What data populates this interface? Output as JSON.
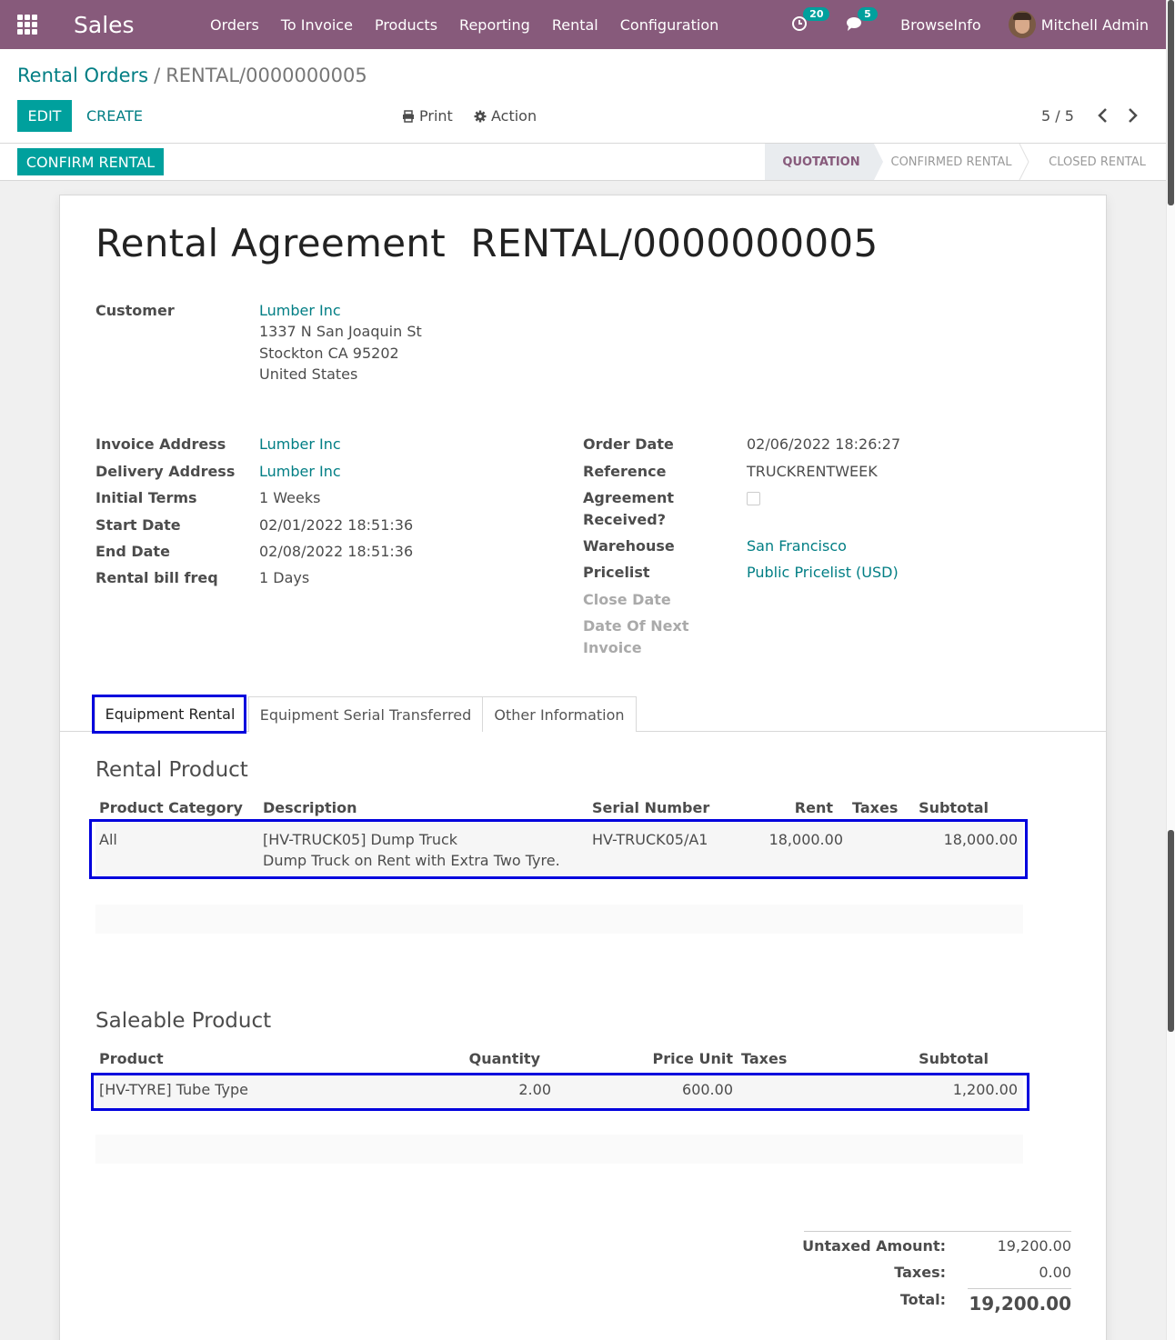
{
  "navbar": {
    "app_name": "Sales",
    "menu": [
      "Orders",
      "To Invoice",
      "Products",
      "Reporting",
      "Rental",
      "Configuration"
    ],
    "activity_count": "20",
    "message_count": "5",
    "company": "BrowseInfo",
    "user": "Mitchell Admin"
  },
  "breadcrumb": {
    "parent": "Rental Orders",
    "separator": "/",
    "current": "RENTAL/0000000005"
  },
  "toolbar": {
    "edit_label": "EDIT",
    "create_label": "CREATE",
    "print_label": "Print",
    "action_label": "Action",
    "pager": "5 / 5"
  },
  "statusbar": {
    "confirm_label": "CONFIRM RENTAL",
    "stages": [
      "QUOTATION",
      "CONFIRMED RENTAL",
      "CLOSED RENTAL"
    ],
    "active_stage": "QUOTATION"
  },
  "form": {
    "title": "Rental Agreement  RENTAL/0000000005",
    "customer_label": "Customer",
    "customer_name": "Lumber Inc",
    "customer_address": [
      "1337 N San Joaquin St",
      "Stockton CA 95202",
      "United States"
    ],
    "left_fields": [
      {
        "label": "Invoice Address",
        "value": "Lumber Inc"
      },
      {
        "label": "Delivery Address",
        "value": "Lumber Inc"
      },
      {
        "label": "Initial Terms",
        "value": "1 Weeks"
      },
      {
        "label": "Start Date",
        "value": "02/01/2022 18:51:36"
      },
      {
        "label": "End Date",
        "value": "02/08/2022 18:51:36"
      },
      {
        "label": "Rental bill freq",
        "value": "1 Days"
      }
    ],
    "right_fields": {
      "order_date_label": "Order Date",
      "order_date": "02/06/2022 18:26:27",
      "reference_label": "Reference",
      "reference": "TRUCKRENTWEEK",
      "agreement_label_1": "Agreement",
      "agreement_label_2": "Received?",
      "agreement_received": false,
      "warehouse_label": "Warehouse",
      "warehouse": "San Francisco",
      "pricelist_label": "Pricelist",
      "pricelist": "Public Pricelist (USD)",
      "close_date_label": "Close Date",
      "next_invoice_label_1": "Date Of Next",
      "next_invoice_label_2": "Invoice"
    }
  },
  "tabs": [
    "Equipment Rental",
    "Equipment Serial Transferred",
    "Other Information"
  ],
  "rental_product": {
    "title": "Rental Product",
    "columns": [
      "Product Category",
      "Description",
      "Serial Number",
      "Rent",
      "Taxes",
      "Subtotal"
    ],
    "rows": [
      {
        "category": "All",
        "description_1": "[HV-TRUCK05] Dump Truck",
        "description_2": "Dump Truck on Rent with Extra Two Tyre.",
        "serial": "HV-TRUCK05/A1",
        "rent": "18,000.00",
        "taxes": "",
        "subtotal": "18,000.00"
      }
    ]
  },
  "saleable_product": {
    "title": "Saleable Product",
    "columns": [
      "Product",
      "Quantity",
      "Price Unit",
      "Taxes",
      "Subtotal"
    ],
    "rows": [
      {
        "product": "[HV-TYRE] Tube Type",
        "quantity": "2.00",
        "price_unit": "600.00",
        "taxes": "",
        "subtotal": "1,200.00"
      }
    ]
  },
  "totals": {
    "untaxed_label": "Untaxed Amount:",
    "untaxed": "19,200.00",
    "taxes_label": "Taxes:",
    "taxes": "0.00",
    "total_label": "Total:",
    "total": "19,200.00"
  },
  "colors": {
    "navbar": "#875a7b",
    "primary": "#00a09d",
    "link": "#017e84",
    "highlight": "#0000dd"
  }
}
